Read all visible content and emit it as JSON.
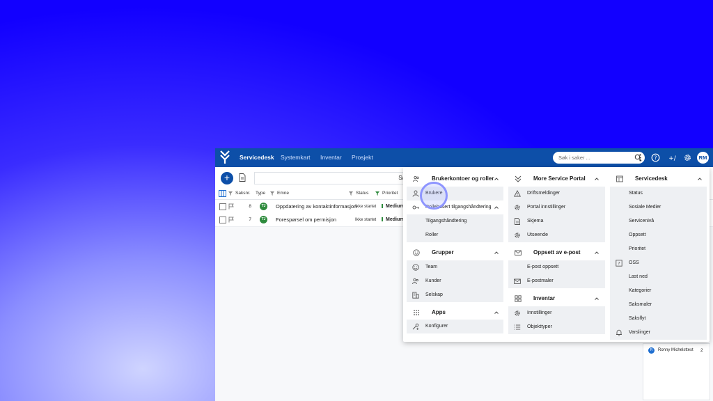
{
  "topbar": {
    "nav": [
      "Servicedesk",
      "Systemkart",
      "Inventar",
      "Prosjekt"
    ],
    "search_placeholder": "Søk i saker ...",
    "avatar_initials": "RM"
  },
  "toolbar": {
    "filter_text": "Sa"
  },
  "table": {
    "columns": [
      "Saksnr.",
      "Type",
      "Emne",
      "Status",
      "Prioritet"
    ],
    "rows": [
      {
        "id": "8",
        "type": "TJ",
        "subject": "Oppdatering av kontaktinformasjon",
        "status": "Ikke startet",
        "priority": "Medium"
      },
      {
        "id": "7",
        "type": "TJ",
        "subject": "Forespørsel om permisjon",
        "status": "Ikke startet",
        "priority": "Medium"
      }
    ]
  },
  "right_panel": {
    "user_initial": "R",
    "user_name": "Ronny Michelsttest",
    "count": "2"
  },
  "menu": {
    "col1": {
      "accounts": {
        "title": "Brukerkontoer og roller",
        "users": "Brukere",
        "access_sub": "Rollebasert tilgangshåndtering",
        "access": "Tilgangshåndtering",
        "roles": "Roller"
      },
      "groups": {
        "title": "Grupper",
        "team": "Team",
        "customers": "Kunder",
        "company": "Selskap"
      },
      "apps": {
        "title": "Apps",
        "configure": "Konfigurer"
      }
    },
    "col2": {
      "portal": {
        "title": "More Service Portal",
        "ops": "Driftsmeldinger",
        "settings": "Portal innstillinger",
        "form": "Skjema",
        "look": "Utseende"
      },
      "email": {
        "title": "Oppsett av e-post",
        "setup": "E-post oppsett",
        "templates": "E-postmaler"
      },
      "inventory": {
        "title": "Inventar",
        "settings": "Innstillinger",
        "types": "Objekttyper"
      }
    },
    "col3": {
      "title": "Servicedesk",
      "items": [
        "Status",
        "Sosiale Medier",
        "Servicenivå",
        "Oppsett",
        "Prioritet",
        "OSS",
        "Last ned",
        "Kategorier",
        "Saksmaler",
        "Saksflyt",
        "Varslinger"
      ]
    }
  }
}
